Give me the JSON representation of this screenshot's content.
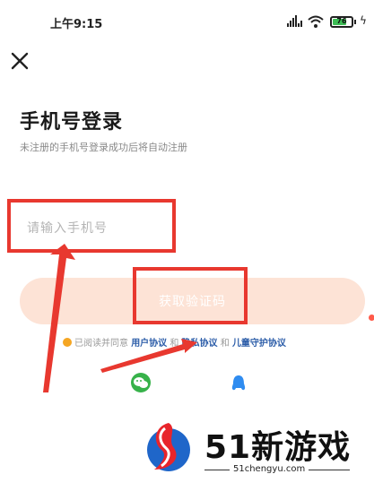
{
  "status_bar": {
    "time": "上午9:15",
    "battery": "76",
    "battery_level": 0.76
  },
  "header": {
    "close_icon": "close-icon"
  },
  "login": {
    "title": "手机号登录",
    "subtitle": "未注册的手机号登录成功后将自动注册",
    "phone_placeholder": "请输入手机号",
    "code_button_label": "获取验证码",
    "agreement": {
      "prefix": "已阅读并同意",
      "user_agreement": "用户协议",
      "and1": "和",
      "privacy": "隐私协议",
      "and2": "和",
      "child": "儿童守护协议"
    }
  },
  "third_party": {
    "wechat_icon": "wechat-icon",
    "qq_icon": "qq-icon"
  },
  "watermark": {
    "site_name": "51新游戏",
    "url": "51chengyu.com"
  },
  "colors": {
    "button_bg": "#fde3d6",
    "annotation_red": "#e8382f",
    "link_blue": "#2b5ca8"
  }
}
